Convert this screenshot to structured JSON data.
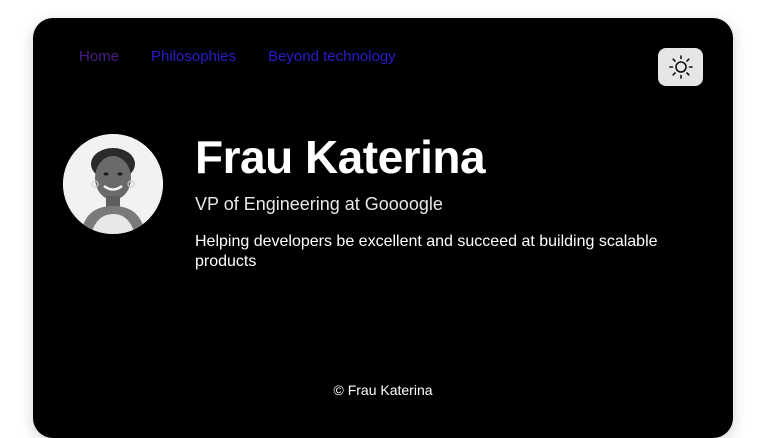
{
  "nav": {
    "items": [
      {
        "label": "Home",
        "color": "#4a1d86"
      },
      {
        "label": "Philosophies",
        "color": "#2a1ccc"
      },
      {
        "label": "Beyond technology",
        "color": "#2a1ccc"
      }
    ]
  },
  "theme_toggle": {
    "icon": "sun-icon"
  },
  "profile": {
    "avatar": "profile-photo",
    "name": "Frau Katerina",
    "role": "VP of Engineering at Goooogle",
    "tagline": "Helping developers be excellent and succeed at building scalable products"
  },
  "footer": {
    "text": "© Frau Katerina"
  },
  "colors": {
    "card_background": "#000000",
    "page_background": "#ffffff",
    "toggle_background": "#e6e6e6"
  }
}
